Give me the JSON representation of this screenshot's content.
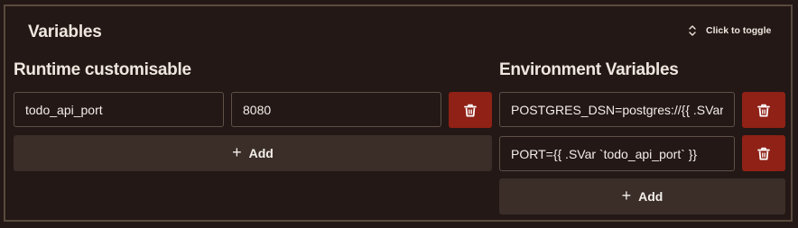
{
  "panel": {
    "title": "Variables",
    "toggle_label": "Click to toggle"
  },
  "runtime": {
    "title": "Runtime customisable",
    "rows": [
      {
        "name": "todo_api_port",
        "value": "8080"
      }
    ],
    "add_label": "Add"
  },
  "environment": {
    "title": "Environment Variables",
    "rows": [
      {
        "value": "POSTGRES_DSN=postgres://{{ .SVar `todo_api_user` }}"
      },
      {
        "value": "PORT={{ .SVar `todo_api_port` }}"
      }
    ],
    "add_label": "Add"
  },
  "icons": {
    "toggle": "chevron-up-down-icon",
    "delete": "trash-icon",
    "add": "plus-icon"
  },
  "colors": {
    "background": "#231815",
    "danger": "#8f2116",
    "add_button": "#3b2e29",
    "border": "#5a4a3e"
  }
}
